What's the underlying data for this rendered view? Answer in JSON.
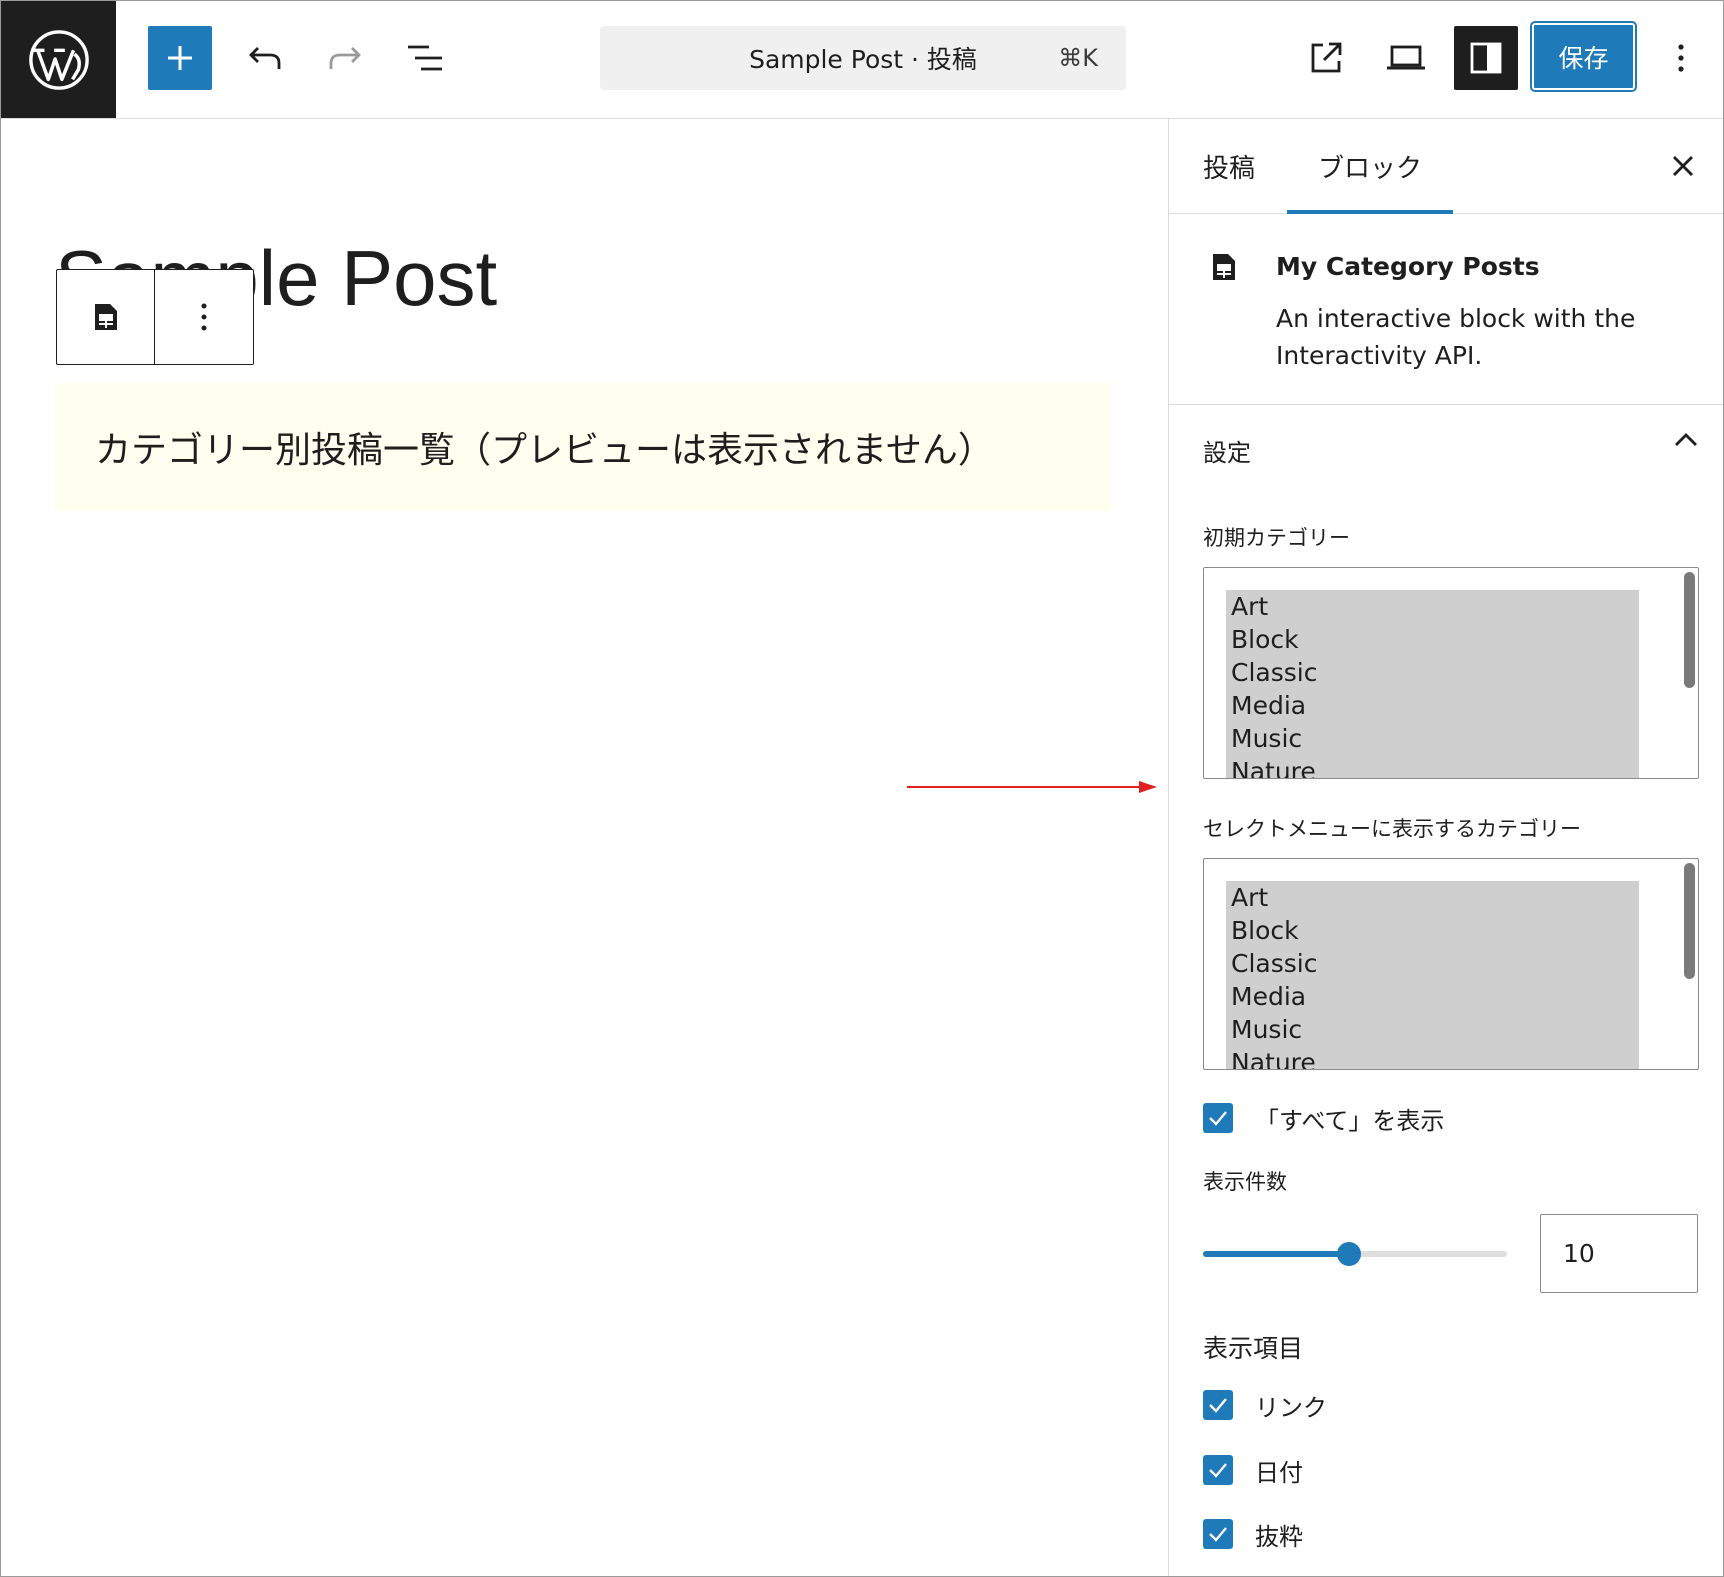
{
  "toolbar": {
    "document_title": "Sample Post · 投稿",
    "shortcut": "⌘K",
    "save_label": "保存"
  },
  "editor": {
    "post_title": "Sample Post",
    "placeholder_text": "カテゴリー別投稿一覧（プレビューは表示されません）"
  },
  "sidebar": {
    "tabs": [
      {
        "label": "投稿",
        "active": false
      },
      {
        "label": "ブロック",
        "active": true
      }
    ],
    "block": {
      "title": "My Category Posts",
      "description": "An interactive block with the Interactivity API."
    },
    "panel": {
      "title": "設定",
      "initial_category": {
        "label": "初期カテゴリー",
        "options": [
          "Art",
          "Block",
          "Classic",
          "Media",
          "Music",
          "Nature"
        ]
      },
      "menu_categories": {
        "label": "セレクトメニューに表示するカテゴリー",
        "options": [
          "Art",
          "Block",
          "Classic",
          "Media",
          "Music",
          "Nature"
        ]
      },
      "show_all": {
        "label": "「すべて」を表示",
        "checked": true
      },
      "count": {
        "label": "表示件数",
        "value": "10",
        "slider_fraction": 0.48
      },
      "display_items": {
        "title": "表示項目",
        "items": [
          {
            "label": "リンク",
            "checked": true
          },
          {
            "label": "日付",
            "checked": true
          },
          {
            "label": "抜粋",
            "checked": true
          }
        ]
      }
    }
  },
  "colors": {
    "accent": "#1e7ab8",
    "dark": "#1e1e1e",
    "annotation": "#e02020",
    "placeholder_bg": "#fffff0"
  }
}
